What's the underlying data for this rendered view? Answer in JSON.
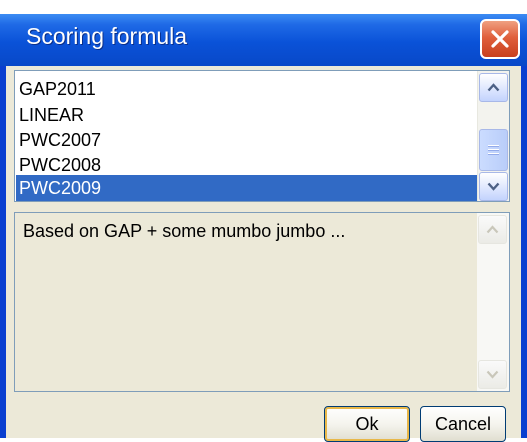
{
  "dialog": {
    "title": "Scoring formula",
    "close_label": "Close"
  },
  "formula_list": {
    "items": [
      "GAP2011",
      "LINEAR",
      "PWC2007",
      "PWC2008",
      "PWC2009"
    ],
    "selected": "PWC2009"
  },
  "description": {
    "text": "Based on GAP + some mumbo jumbo ..."
  },
  "buttons": {
    "ok_label": "Ok",
    "cancel_label": "Cancel"
  },
  "icons": {
    "close": "close-x-icon",
    "scroll_up": "scroll-up-arrow-icon",
    "scroll_down": "scroll-down-arrow-icon"
  },
  "colors": {
    "titlebar": "#0a52d8",
    "selection": "#316ac5",
    "close_button": "#e0603c",
    "client_bg": "#ece9d8"
  }
}
